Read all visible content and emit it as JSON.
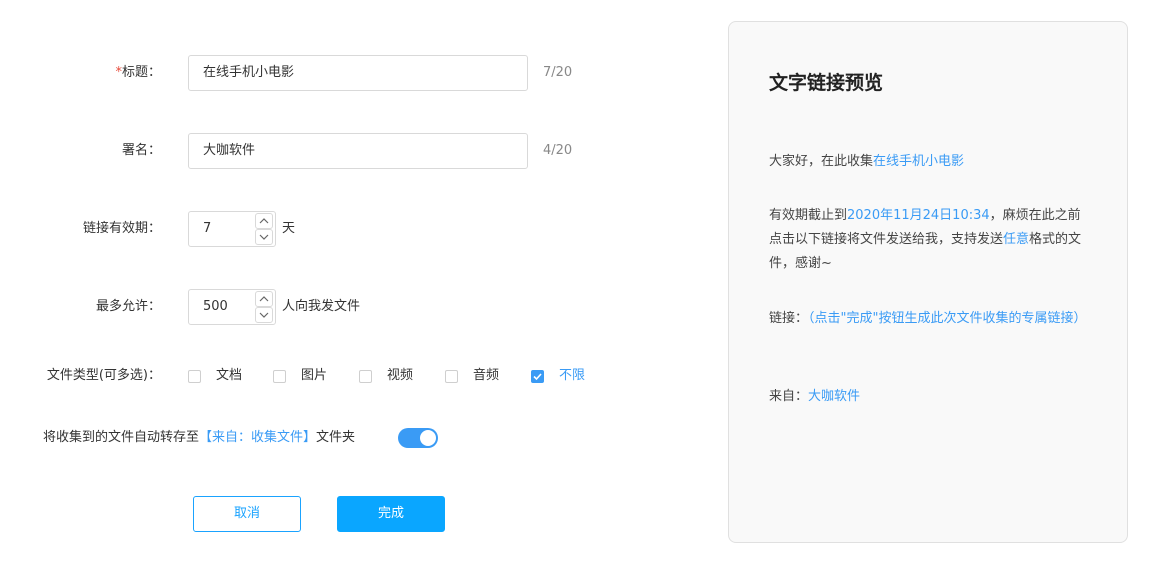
{
  "form": {
    "title": {
      "required_mark": "*",
      "label": "标题：",
      "value": "在线手机小电影",
      "counter": "7/20"
    },
    "signature": {
      "label": "署名：",
      "value": "大咖软件",
      "counter": "4/20"
    },
    "validity": {
      "label": "链接有效期：",
      "value": "7",
      "unit": "天"
    },
    "max_allowed": {
      "label": "最多允许：",
      "value": "500",
      "unit": "人向我发文件"
    },
    "file_types": {
      "label": "文件类型(可多选)：",
      "options": [
        {
          "label": "文档",
          "checked": false
        },
        {
          "label": "图片",
          "checked": false
        },
        {
          "label": "视频",
          "checked": false
        },
        {
          "label": "音频",
          "checked": false
        },
        {
          "label": "不限",
          "checked": true
        }
      ]
    },
    "auto_save": {
      "prefix": "将收集到的文件自动转存至",
      "folder_link": "【来自：收集文件】",
      "suffix": "文件夹",
      "enabled": true
    },
    "cancel_label": "取消",
    "done_label": "完成"
  },
  "preview": {
    "heading": "文字链接预览",
    "greeting_prefix": "大家好，在此收集",
    "greeting_title": "在线手机小电影",
    "deadline_prefix": "有效期截止到",
    "deadline_date": "2020年11月24日10:34",
    "deadline_middle": "，麻烦在此之前点击以下链接将文件发送给我，支持发送",
    "deadline_type": "任意",
    "deadline_suffix": "格式的文件，感谢~",
    "link_label": "链接：",
    "link_text": "（点击\"完成\"按钮生成此次文件收集的专属链接）",
    "from_label": "来自：",
    "from_value": "大咖软件"
  },
  "colors": {
    "accent": "#3a9bf5",
    "primary_button": "#0aa6ff",
    "required": "#e74c3c"
  }
}
